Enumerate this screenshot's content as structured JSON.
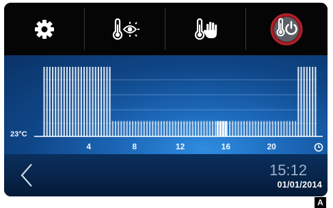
{
  "toolbar": {
    "buttons": [
      {
        "icon": "gear-icon"
      },
      {
        "icon": "thermometer-eye-icon"
      },
      {
        "icon": "thermometer-hand-icon"
      },
      {
        "icon": "thermometer-power-icon",
        "active": true
      }
    ]
  },
  "graph": {
    "temperature_label": "23°C",
    "hours": [
      "4",
      "8",
      "12",
      "16",
      "20"
    ],
    "end_icon": "clock-icon",
    "comfort_level": 1.0,
    "reduced_level": 0.22,
    "comfort_hours": [
      [
        0,
        6
      ],
      [
        22.25,
        24
      ]
    ]
  },
  "footer": {
    "time": "15:12",
    "date": "01/01/2014"
  },
  "corner_letter": "A",
  "colors": {
    "active_ring": "#b4202a",
    "panel_blue": "#1c67b8"
  }
}
